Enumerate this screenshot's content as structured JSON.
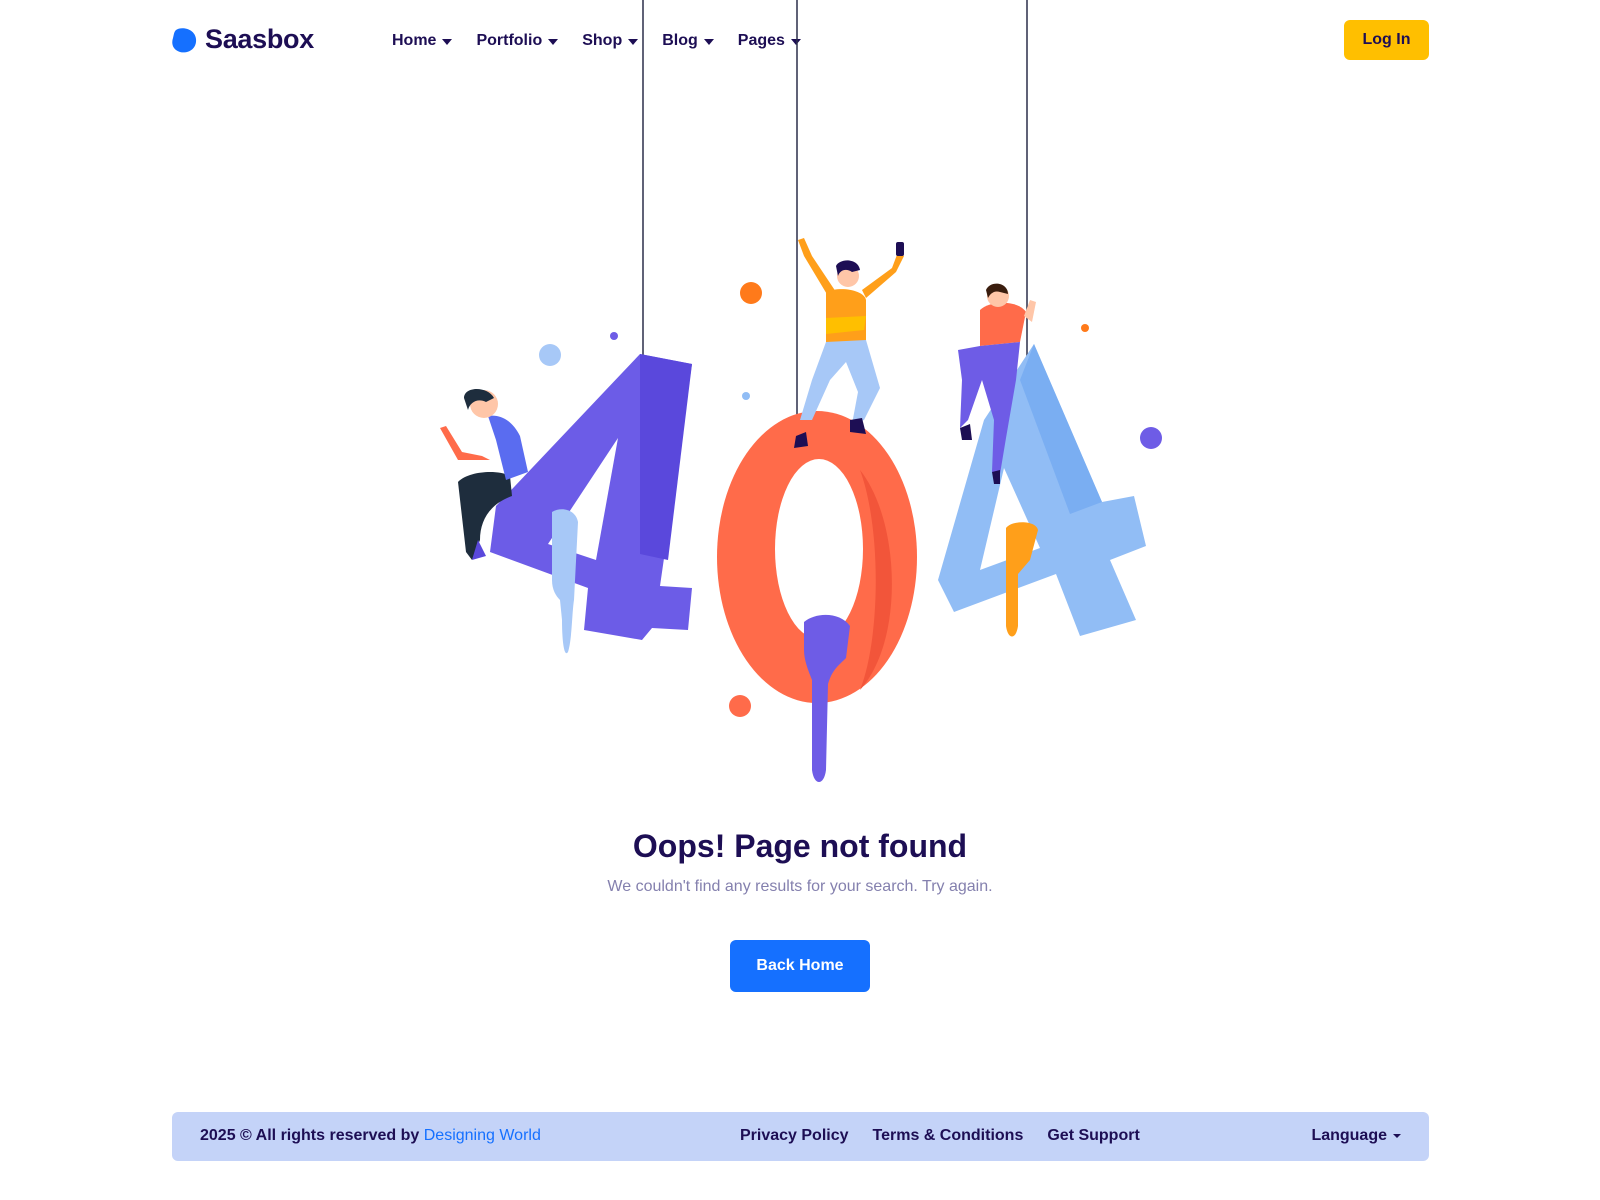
{
  "header": {
    "brand": "Saasbox",
    "nav": [
      {
        "label": "Home"
      },
      {
        "label": "Portfolio"
      },
      {
        "label": "Shop"
      },
      {
        "label": "Blog"
      },
      {
        "label": "Pages"
      }
    ],
    "login_label": "Log In"
  },
  "illustration": {
    "digits": [
      "4",
      "0",
      "4"
    ],
    "colors": {
      "first_four": "#6c5ce7",
      "zero": "#ff6b4a",
      "last_four": "#91bdf5",
      "drip_blue": "#a7c8f7",
      "drip_purple": "#6e5ce6",
      "drip_orange": "#ff9f1a"
    }
  },
  "main": {
    "title": "Oops! Page not found",
    "subtitle": "We couldn't find any results for your search. Try again.",
    "back_label": "Back Home"
  },
  "footer": {
    "copyright_prefix": "2025 © All rights reserved by",
    "copyright_link": "Designing World",
    "links": [
      {
        "label": "Privacy Policy"
      },
      {
        "label": "Terms & Conditions"
      },
      {
        "label": "Get Support"
      }
    ],
    "language_label": "Language"
  },
  "colors": {
    "primary": "#1570ff",
    "accent": "#ffbf00",
    "heading": "#1d0e54",
    "muted": "#8480ae",
    "footer_bg": "#c4d3f8"
  }
}
